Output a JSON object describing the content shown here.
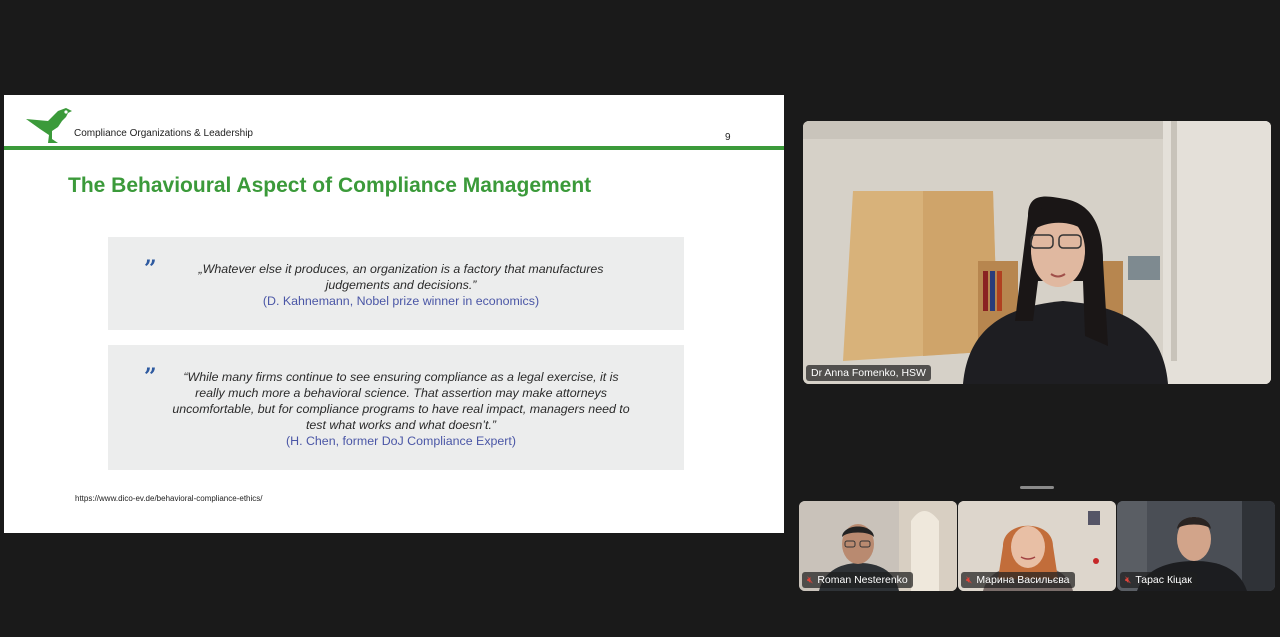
{
  "slide": {
    "header": "Compliance Organizations & Leadership",
    "page_number": "9",
    "title": "The Behavioural Aspect of Compliance Management",
    "quotes": [
      {
        "mark": "”",
        "text": "„Whatever else it produces, an organization is a factory that manufactures judgements and decisions.”",
        "author": "(D. Kahnemann, Nobel prize winner in economics)"
      },
      {
        "mark": "”",
        "text": "“While many firms continue to see ensuring compliance as a legal exercise, it is really much more a behavioral science. That assertion may make attorneys uncomfortable, but for compliance programs to have real impact, managers need to test what works and what doesn’t.”",
        "author": "(H. Chen, former DoJ Compliance Expert)"
      }
    ],
    "url": "https://www.dico-ev.de/behavioral-compliance-ethics/",
    "logo_icon": "bird-logo-icon",
    "accent_color": "#3b9a3a"
  },
  "speaker": {
    "name": "Dr Anna Fomenko, HSW"
  },
  "participants": [
    {
      "name": "Roman Nesterenko",
      "muted": true
    },
    {
      "name": "Марина Васильєва",
      "muted": true
    },
    {
      "name": "Тарас Кіцак",
      "muted": true
    }
  ],
  "icons": {
    "muted_mic": "muted-mic-icon"
  }
}
